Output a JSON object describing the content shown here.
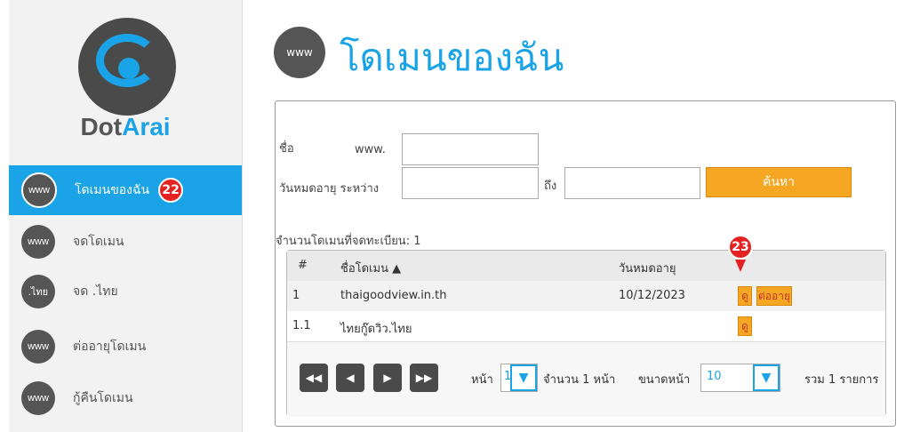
{
  "brand": {
    "name_part1": "Dot",
    "name_part2": "Arai"
  },
  "sidebar": {
    "items": [
      {
        "icon_text": "www",
        "label": "โดเมนของฉัน",
        "badge": "22"
      },
      {
        "icon_text": "www",
        "label": "จดโดเมน"
      },
      {
        "icon_text": ".ไทย",
        "label": "จด .ไทย"
      },
      {
        "icon_text": "www",
        "label": "ต่ออายุโดเมน"
      },
      {
        "icon_text": "www",
        "label": "กู้คืนโดเมน"
      }
    ]
  },
  "page": {
    "title": "โดเมนของฉัน",
    "title_icon_text": "www"
  },
  "filters": {
    "name_label": "ชื่อ",
    "www_prefix": "www.",
    "expiry_label": "วันหมดอายุ ระหว่าง",
    "to_label": "ถึง",
    "search_label": "ค้นหา"
  },
  "summary": {
    "count_label": "จำนวนโดเมนที่จดทะเบียน: 1"
  },
  "table": {
    "headers": {
      "num": "#",
      "domain": "ชื่อโดเมน ▲",
      "expiry": "วันหมดอายุ"
    },
    "rows": [
      {
        "num": "1",
        "domain": "thaigoodview.in.th",
        "expiry": "10/12/2023",
        "view": "ดู",
        "renew": "ต่ออายุ"
      },
      {
        "num": "1.1",
        "domain": "ไทยกู๊ดวิว.ไทย",
        "expiry": "",
        "view": "ดู"
      }
    ]
  },
  "pager": {
    "page_label": "หน้า",
    "page_value": "1",
    "total_pages": "จำนวน 1 หน้า",
    "page_size_label": "ขนาดหน้า",
    "page_size_value": "10",
    "total_items": "รวม 1 รายการ"
  },
  "callout": {
    "number": "23"
  },
  "colors": {
    "accent": "#1aa3e6",
    "button": "#f5a623",
    "badge": "#e52222"
  }
}
